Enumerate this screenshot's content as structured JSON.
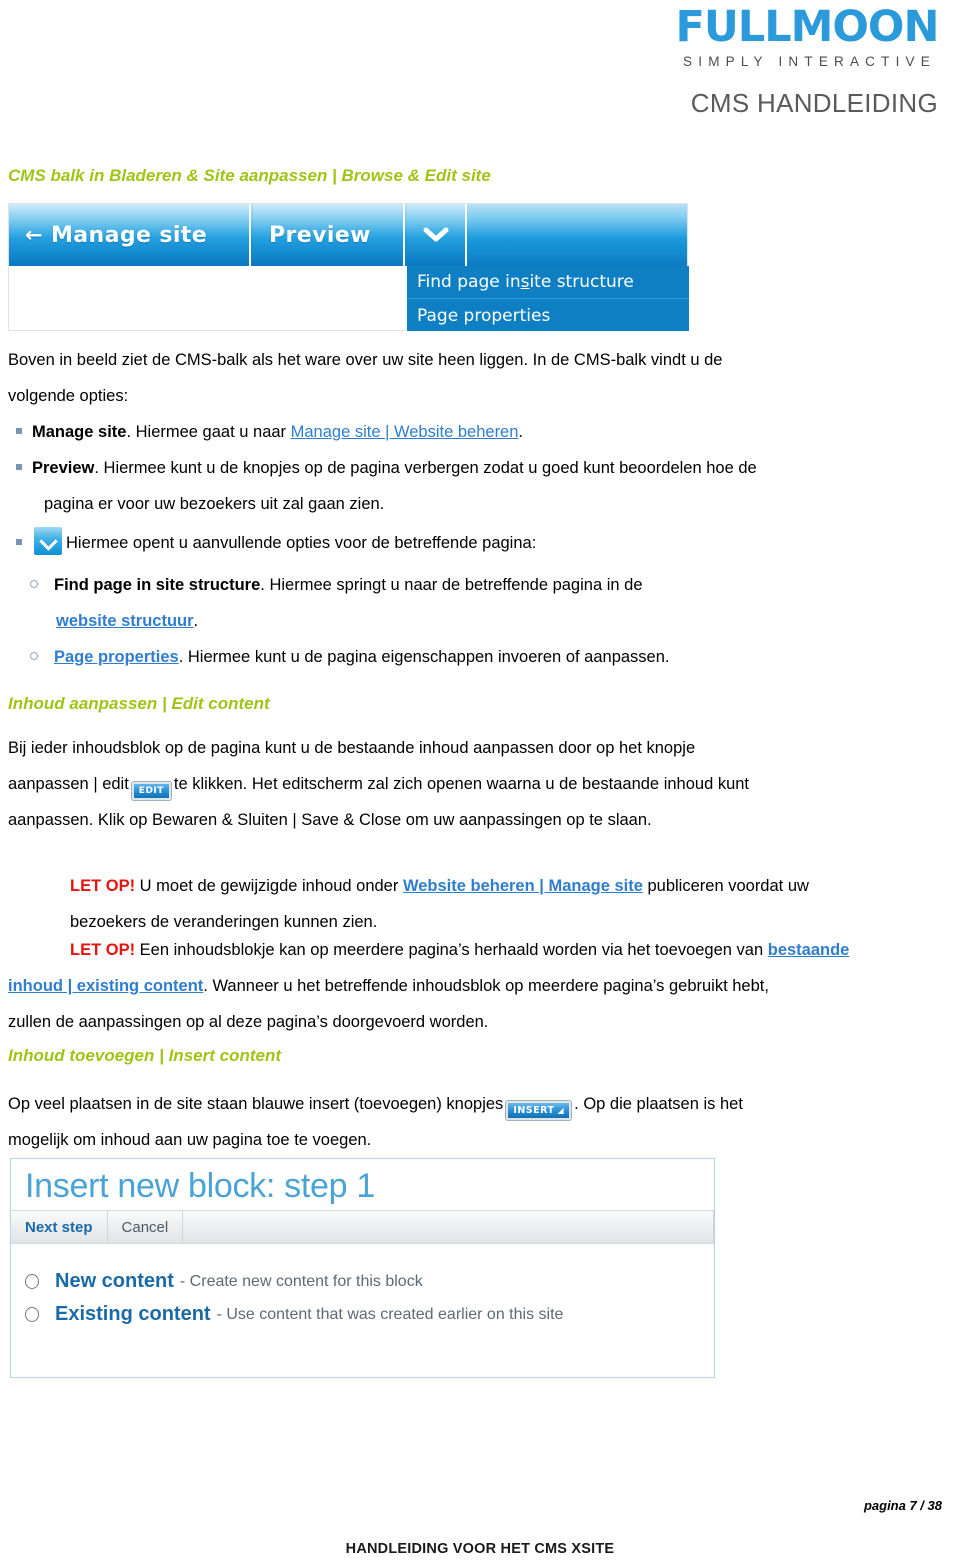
{
  "header": {
    "logo_main": "FULLMOON",
    "logo_sub": "SIMPLY INTERACTIVE",
    "doc_title": "CMS HANDLEIDING",
    "logo_color": "#2b9ada",
    "doc_title_color": "#5a5a5a"
  },
  "sections": {
    "s1_heading": "CMS balk in Bladeren & Site aanpassen | Browse & Edit site",
    "s2_heading": "Inhoud aanpassen | Edit content",
    "s3_heading": "Inhoud toevoegen | Insert content",
    "heading_color": "#9fc316"
  },
  "cms_toolbar_screenshot": {
    "back_arrow": "←",
    "manage_site_label": "Manage site",
    "preview_label": "Preview",
    "chevron_glyph": "❯",
    "menu_items": [
      {
        "pre": "Find page in ",
        "underlined": "s",
        "post": "ite structure"
      },
      {
        "pre": "Page properties",
        "underlined": "",
        "post": ""
      }
    ],
    "accent_blue": "#0f7fc4"
  },
  "intro": {
    "p1_a": "Boven in beeld ziet de CMS-balk als het ware over uw site heen liggen. In de CMS-balk vindt u de",
    "p1_b": "volgende opties:"
  },
  "bullets": [
    {
      "strong": "Manage site",
      "mid": ". Hiermee gaat u naar ",
      "link": "Manage site | Website beheren",
      "tail": "."
    },
    {
      "strong": "Preview",
      "mid": ". Hiermee kunt u de knopjes op de pagina verbergen zodat u goed kunt beoordelen hoe de",
      "cont": "pagina er voor uw bezoekers uit zal gaan zien."
    },
    {
      "icon": "chevron-down-square-icon",
      "text": "Hiermee opent u aanvullende opties voor de betreffende pagina:"
    }
  ],
  "subbullets": [
    {
      "strong": "Find page in site structure",
      "mid": ". Hiermee springt u naar de betreffende pagina in de",
      "link": "website structuur",
      "tail": "."
    },
    {
      "link": "Page properties",
      "mid": ". Hiermee kunt u de pagina eigenschappen invoeren of aanpassen."
    }
  ],
  "edit_content": {
    "l1": "Bij ieder inhoudsblok op de pagina kunt u de bestaande inhoud aanpassen door op het knopje",
    "l2_a": "aanpassen | edit",
    "edit_button_label": "EDIT",
    "l2_b": "te klikken. Het editscherm zal zich openen waarna u de bestaande inhoud kunt",
    "l3": "aanpassen. Klik op Bewaren & Sluiten | Save & Close om uw aanpassingen op te slaan."
  },
  "notes": [
    {
      "label": "LET OP!",
      "a": " U moet de gewijzigde inhoud onder ",
      "link": "Website beheren | Manage site",
      "b": " publiceren voordat uw",
      "cont": "bezoekers de veranderingen kunnen zien."
    },
    {
      "label": "LET OP!",
      "a": " Een inhoudsblokje kan op meerdere pagina’s herhaald worden via het toevoegen van ",
      "link_part1": "bestaande",
      "link_part2": "inhoud | existing content",
      "b": ". Wanneer u het betreffende inhoudsblok op meerdere pagina’s gebruikt hebt,",
      "cont": "zullen de aanpassingen op al deze pagina’s doorgevoerd worden."
    }
  ],
  "insert_content": {
    "l1_a": "Op veel plaatsen in de site staan blauwe insert (toevoegen) knopjes",
    "insert_button_label": "INSERT",
    "l1_b": ". Op die plaatsen is het",
    "l2": "mogelijk om inhoud aan uw pagina toe te voegen."
  },
  "insert_screenshot": {
    "title": "Insert new block: step 1",
    "next_step_label": "Next step",
    "cancel_label": "Cancel",
    "options": [
      {
        "name": "New content",
        "desc": "- Create new content for this block"
      },
      {
        "name": "Existing content",
        "desc": "- Use content that was created earlier on this site"
      }
    ],
    "title_color": "#4aa3d8"
  },
  "footer": {
    "page_number": "pagina 7 / 38",
    "footer_text": "HANDLEIDING VOOR HET CMS XSITE"
  }
}
